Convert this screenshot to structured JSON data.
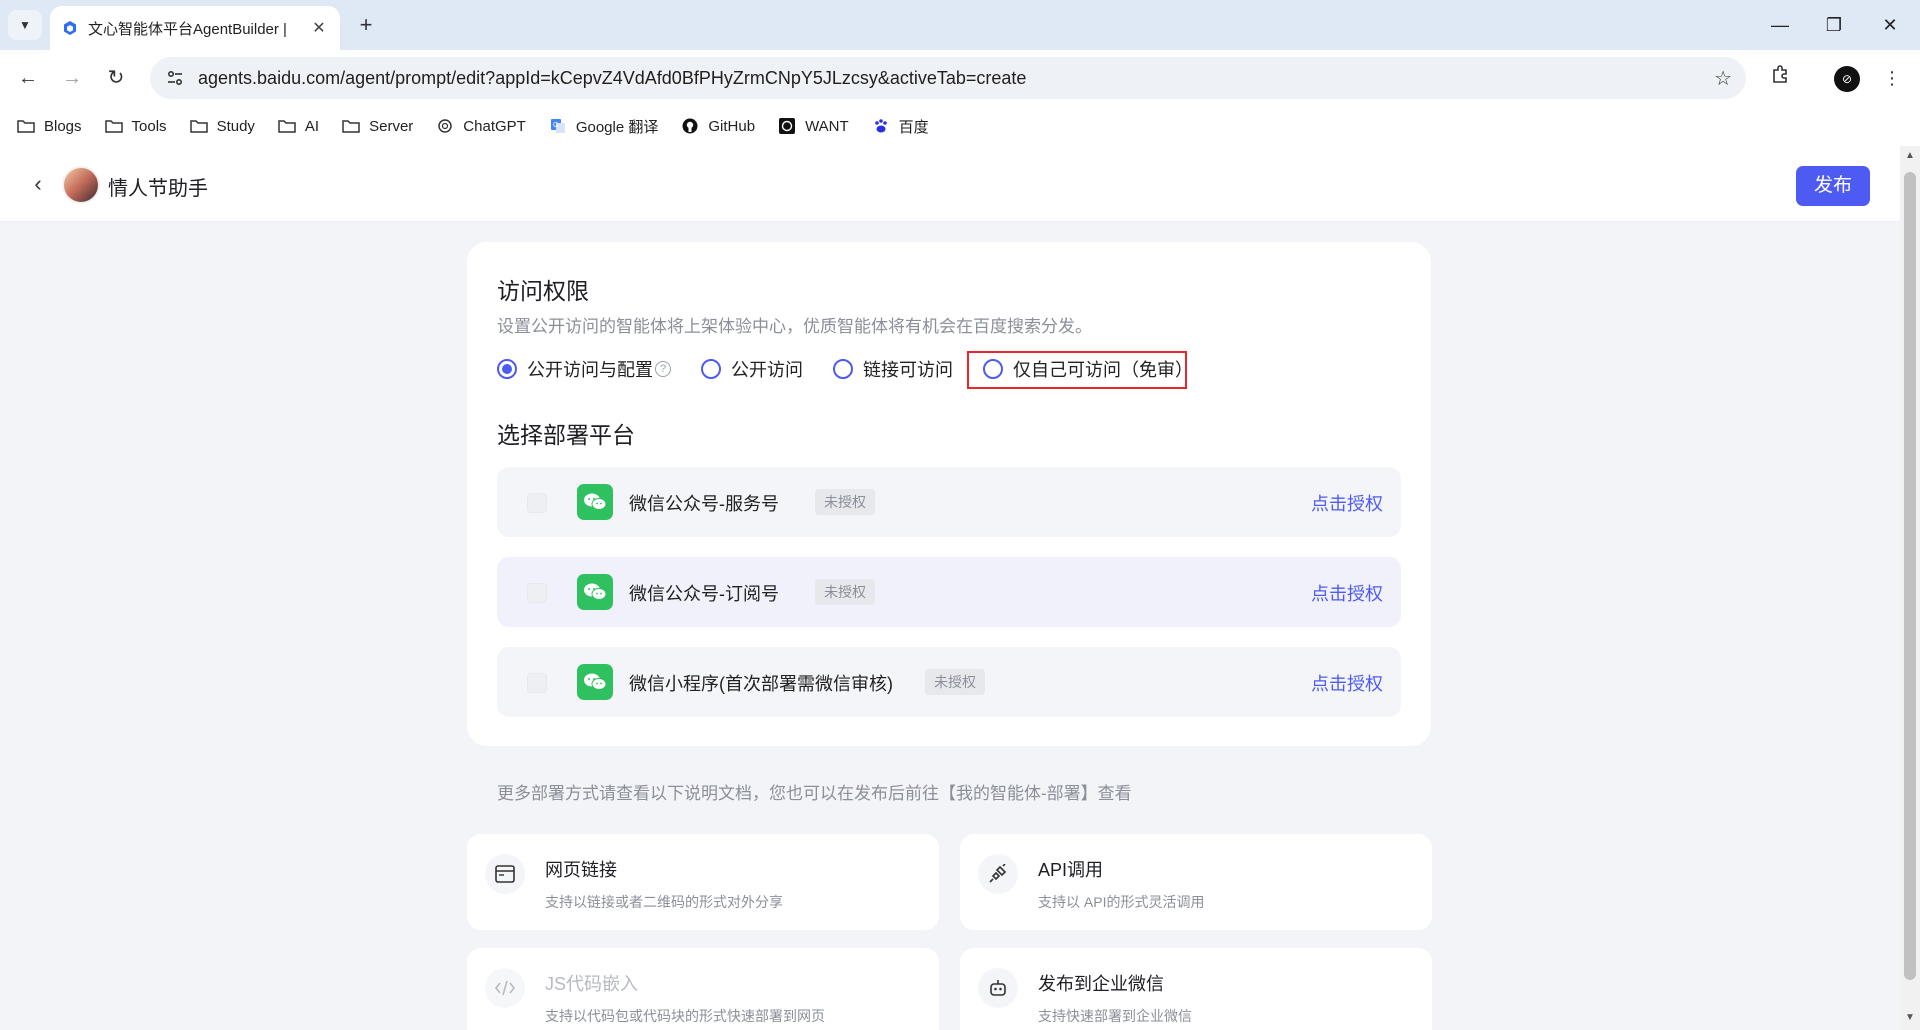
{
  "browser": {
    "tab_title": "文心智能体平台AgentBuilder |",
    "url": "agents.baidu.com/agent/prompt/edit?appId=kCepvZ4VdAfd0BfPHyZrmCNpY5JLzcsy&activeTab=create",
    "bookmarks": [
      {
        "label": "Blogs",
        "icon": "folder-icon"
      },
      {
        "label": "Tools",
        "icon": "folder-icon"
      },
      {
        "label": "Study",
        "icon": "folder-icon"
      },
      {
        "label": "AI",
        "icon": "folder-icon"
      },
      {
        "label": "Server",
        "icon": "folder-icon"
      },
      {
        "label": "ChatGPT",
        "icon": "openai-icon"
      },
      {
        "label": "Google 翻译",
        "icon": "translate-icon"
      },
      {
        "label": "GitHub",
        "icon": "github-icon"
      },
      {
        "label": "WANT",
        "icon": "want-icon"
      },
      {
        "label": "百度",
        "icon": "baidu-icon"
      }
    ]
  },
  "header": {
    "agent_name": "情人节助手",
    "publish_label": "发布"
  },
  "access": {
    "title": "访问权限",
    "description": "设置公开访问的智能体将上架体验中心，优质智能体将有机会在百度搜索分发。",
    "options": [
      {
        "label": "公开访问与配置",
        "checked": true
      },
      {
        "label": "公开访问",
        "checked": false
      },
      {
        "label": "链接可访问",
        "checked": false
      },
      {
        "label": "仅自己可访问（免审）",
        "checked": false
      }
    ]
  },
  "platforms": {
    "title": "选择部署平台",
    "items": [
      {
        "name": "微信公众号-服务号",
        "badge": "未授权",
        "action": "点击授权"
      },
      {
        "name": "微信公众号-订阅号",
        "badge": "未授权",
        "action": "点击授权"
      },
      {
        "name": "微信小程序(首次部署需微信审核)",
        "badge": "未授权",
        "action": "点击授权"
      }
    ]
  },
  "more_note": "更多部署方式请查看以下说明文档，您也可以在发布后前往【我的智能体-部署】查看",
  "deploy_options": [
    {
      "title": "网页链接",
      "desc": "支持以链接或者二维码的形式对外分享",
      "icon": "browser-window-icon",
      "disabled": false
    },
    {
      "title": "API调用",
      "desc": "支持以 API的形式灵活调用",
      "icon": "plug-icon",
      "disabled": false
    },
    {
      "title": "JS代码嵌入",
      "desc": "支持以代码包或代码块的形式快速部署到网页",
      "icon": "code-icon",
      "disabled": true
    },
    {
      "title": "发布到企业微信",
      "desc": "支持快速部署到企业微信",
      "icon": "robot-icon",
      "disabled": false
    }
  ],
  "colors": {
    "accent": "#4e5bf2",
    "wechat": "#2fc05f",
    "highlight": "#e8262b"
  }
}
